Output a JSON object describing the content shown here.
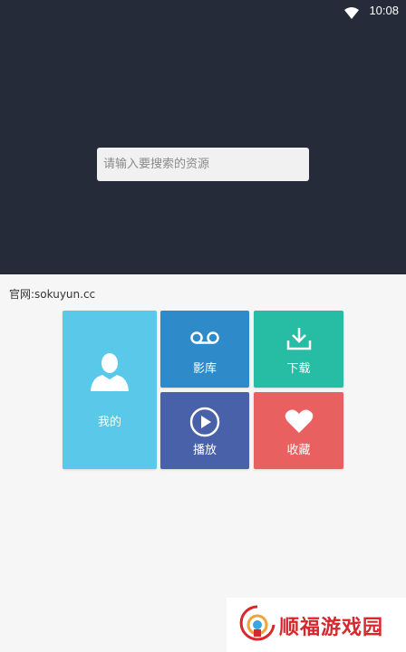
{
  "status_bar": {
    "time": "10:08"
  },
  "search": {
    "placeholder": "请输入要搜索的资源"
  },
  "official_site": "官网:sokuyun.cc",
  "tiles": {
    "mine": "我的",
    "library": "影库",
    "download": "下载",
    "play": "播放",
    "favorites": "收藏"
  },
  "watermark": {
    "text": "顺福游戏园"
  },
  "colors": {
    "header_bg": "#252b39",
    "tile_mine": "#5ac8e8",
    "tile_library": "#2f8ac9",
    "tile_download": "#27bca4",
    "tile_play": "#4961a8",
    "tile_favorites": "#e8605f",
    "watermark": "#d7262c"
  }
}
